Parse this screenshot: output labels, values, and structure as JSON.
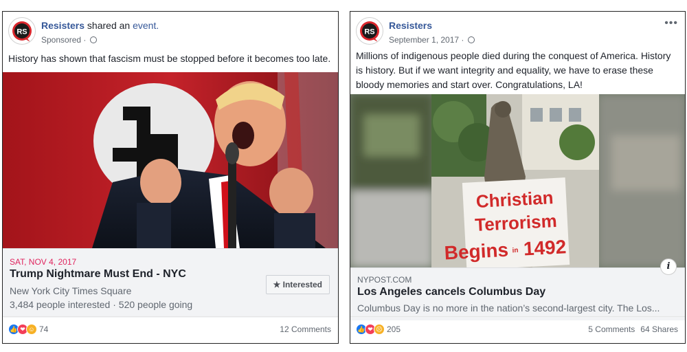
{
  "card1": {
    "page_name": "Resisters",
    "shared_text": " shared an ",
    "shared_link": "event.",
    "subline": "Sponsored · ",
    "post_text": "History has shown that fascism must be stopped before it becomes too late.",
    "event_date": "SAT, NOV 4, 2017",
    "event_title": "Trump Nightmare Must End - NYC",
    "event_location": "New York City Times Square",
    "event_stats": "3,484 people interested · 520 people going",
    "interested_label": "★ Interested",
    "reaction_count": "74",
    "comments": "12 Comments"
  },
  "card2": {
    "page_name": "Resisters",
    "subline": "September 1, 2017 · ",
    "more_label": "•••",
    "post_text": "Millions of indigenous people died during the conquest of America. History is history. But if we want integrity and equality, we have to erase these bloody memories and start over. Congratulations, LA!",
    "sign_line1": "Christian",
    "sign_line2": "Terrorism",
    "sign_line3a": "Begins",
    "sign_line3b": "in",
    "sign_line3c": "1492",
    "info_label": "i",
    "link_domain": "NYPOST.COM",
    "link_title": "Los Angeles cancels Columbus Day",
    "link_desc": "Columbus Day is no more in the nation’s second-largest city. The Los...",
    "reaction_count": "205",
    "comments": "5 Comments",
    "shares": "64 Shares"
  },
  "avatar_text": "RS",
  "colors": {
    "fb_blue": "#365899",
    "event_red": "#e0245e",
    "avatar_red": "#d9262c"
  }
}
